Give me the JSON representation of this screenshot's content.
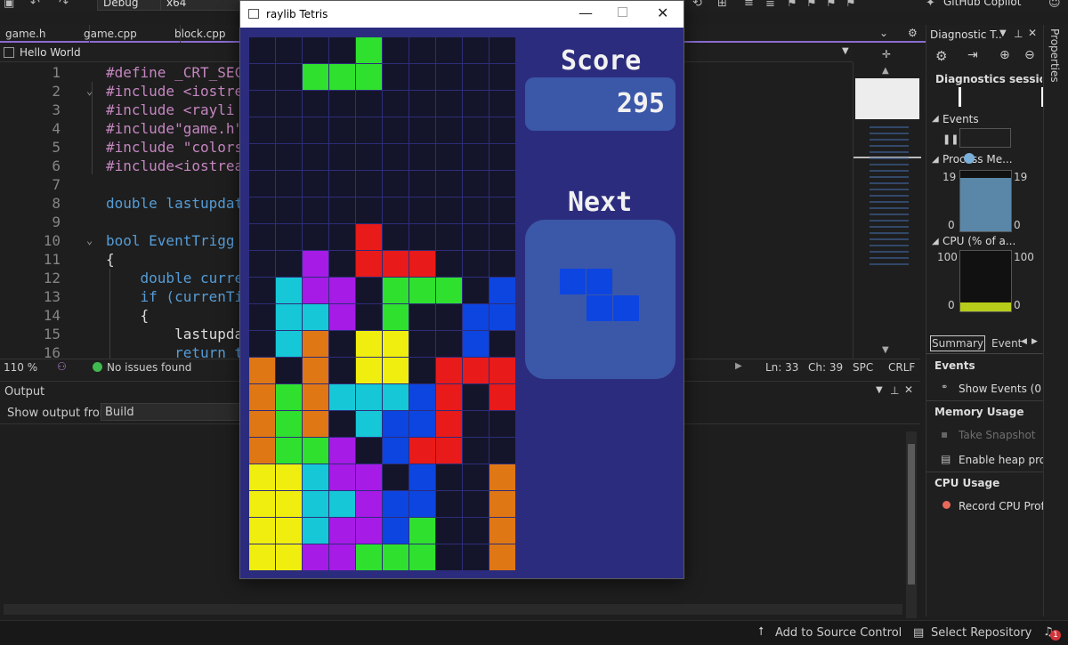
{
  "toolbar": {
    "config": "Debug",
    "platform": "x64",
    "copilot": "GitHub Copilot"
  },
  "doc_tabs": [
    "game.h",
    "game.cpp",
    "block.cpp"
  ],
  "nav_bar": {
    "scope": "Hello World"
  },
  "editor": {
    "lines": [
      {
        "n": "1",
        "fold": "",
        "t": "#define _CRT_SEC"
      },
      {
        "n": "2",
        "fold": "⌄",
        "t": "#include <iostre"
      },
      {
        "n": "3",
        "fold": "",
        "t": "#include <rayli"
      },
      {
        "n": "4",
        "fold": "",
        "t": "#include\"game.h\""
      },
      {
        "n": "5",
        "fold": "",
        "t": "#include \"colors"
      },
      {
        "n": "6",
        "fold": "",
        "t": "#include<iostrea"
      },
      {
        "n": "7",
        "fold": "",
        "t": ""
      },
      {
        "n": "8",
        "fold": "",
        "t": "double lastupdat"
      },
      {
        "n": "9",
        "fold": "",
        "t": ""
      },
      {
        "n": "10",
        "fold": "⌄",
        "t": "bool EventTrigg"
      },
      {
        "n": "11",
        "fold": "",
        "t": "{"
      },
      {
        "n": "12",
        "fold": "",
        "t": "    double curre"
      },
      {
        "n": "13",
        "fold": "",
        "t": "    if (currenTi"
      },
      {
        "n": "14",
        "fold": "",
        "t": "    {"
      },
      {
        "n": "15",
        "fold": "",
        "t": "        lastupda"
      },
      {
        "n": "16",
        "fold": "",
        "t": "        return t"
      }
    ]
  },
  "editor_status": {
    "zoom": "110 %",
    "issues": "No issues found",
    "line": "Ln: 33",
    "col": "Ch: 39",
    "spacing": "SPC",
    "eol": "CRLF"
  },
  "output": {
    "title": "Output",
    "show_from_label": "Show output from:",
    "source": "Build"
  },
  "status_bar": {
    "source_control": "Add to Source Control",
    "repo": "Select Repository",
    "notifications": "1"
  },
  "diagnostics": {
    "title": "Diagnostic T...",
    "session": "Diagnostics session:...",
    "events": "Events",
    "process_mem": "Process Me...",
    "mem_max": "19",
    "mem_min": "0",
    "cpu": "CPU (% of a...",
    "cpu_max": "100",
    "cpu_min": "0",
    "tabs": [
      "Summary",
      "Event"
    ],
    "sec_events": "Events",
    "show_events": "Show Events (0 of",
    "sec_memory": "Memory Usage",
    "take_snapshot": "Take Snapshot",
    "enable_heap": "Enable heap profi",
    "sec_cpu": "CPU Usage",
    "record_cpu": "Record CPU Profil",
    "properties": "Properties"
  },
  "game": {
    "window_title": "raylib Tetris",
    "score_label": "Score",
    "score": "295",
    "next_label": "Next",
    "colors": {
      "G": "#2fe02f",
      "R": "#e81a1a",
      "P": "#a61be6",
      "C": "#16c7d7",
      "B": "#0d45e0",
      "O": "#e07715",
      "Y": "#f0ee0e"
    },
    "grid": [
      "..........",
      "....G.....",
      "..GGG.....",
      "..........",
      "..........",
      "..........",
      "..........",
      "..........",
      "....R.....",
      "..P.RRR...",
      ".CPP.GGG.B",
      ".CCP.G..BB",
      ".CO.YY..B.",
      "O.O.YY.RRR",
      "OGOCCCBR.R",
      "OGO.CBBR..",
      "OGGP.BRR..",
      "YYCPP.B..O",
      "YYCCPBB..O",
      "YYCPPBG..O",
      "YYPPGGG..O"
    ],
    "next_piece": {
      "color": "B",
      "shape": [
        "BB.",
        ".BB"
      ]
    }
  }
}
